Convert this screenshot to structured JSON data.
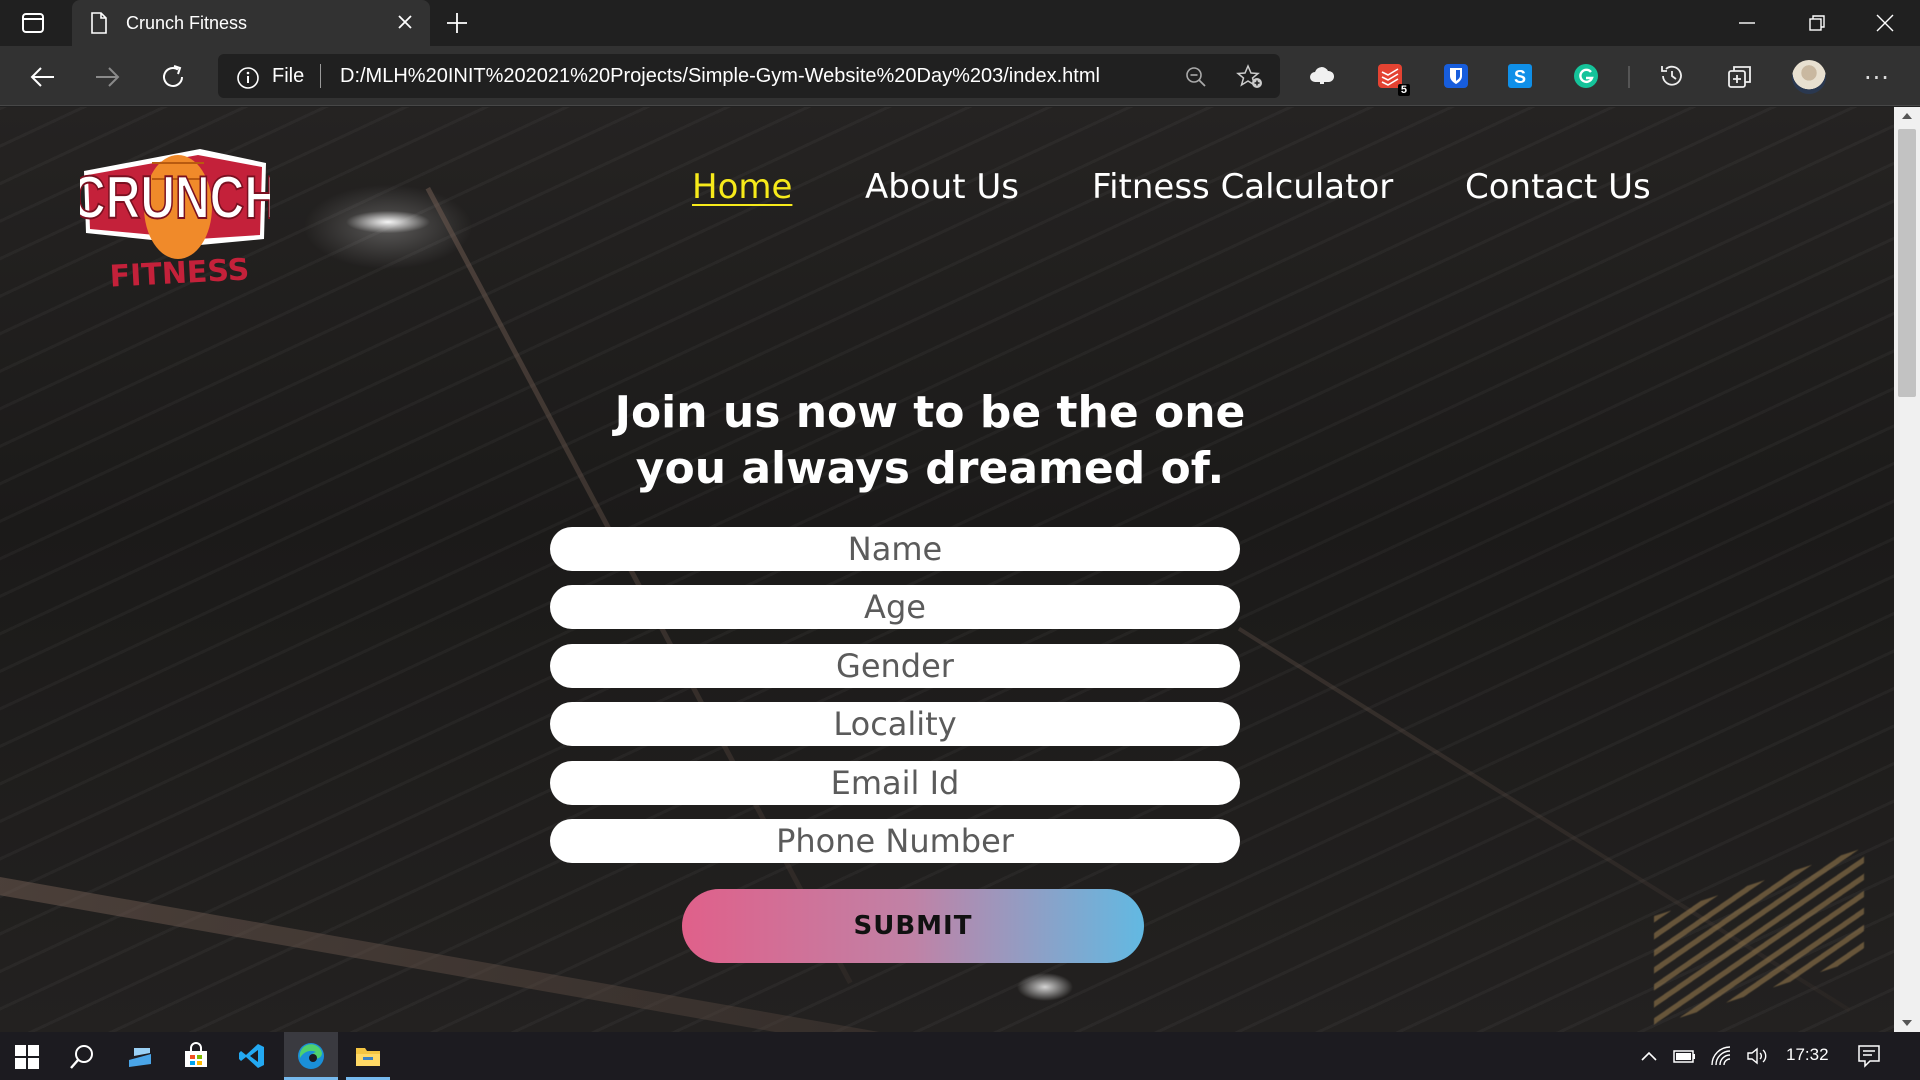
{
  "browser": {
    "tab_title": "Crunch Fitness",
    "address": {
      "scheme_label": "File",
      "url": "D:/MLH%20INIT%202021%20Projects/Simple-Gym-Website%20Day%203/index.html"
    },
    "extension_badge": "5"
  },
  "page": {
    "logo": {
      "top": "CRUNCH",
      "bottom": "FITNESS"
    },
    "nav": [
      {
        "label": "Home",
        "active": true
      },
      {
        "label": "About Us",
        "active": false
      },
      {
        "label": "Fitness Calculator",
        "active": false
      },
      {
        "label": "Contact Us",
        "active": false
      }
    ],
    "heading_line1": "Join us now to be the one",
    "heading_line2": "you always dreamed of.",
    "form": {
      "name_placeholder": "Name",
      "age_placeholder": "Age",
      "gender_placeholder": "Gender",
      "locality_placeholder": "Locality",
      "email_placeholder": "Email Id",
      "phone_placeholder": "Phone Number",
      "submit_label": "SUBMIT"
    }
  },
  "taskbar": {
    "clock": "17:32"
  },
  "colors": {
    "nav_active": "#f7ea1a",
    "submit_gradient_start": "#e0608a",
    "submit_gradient_end": "#62b9e2",
    "logo_red": "#c4213a",
    "logo_orange": "#f08a2a"
  }
}
